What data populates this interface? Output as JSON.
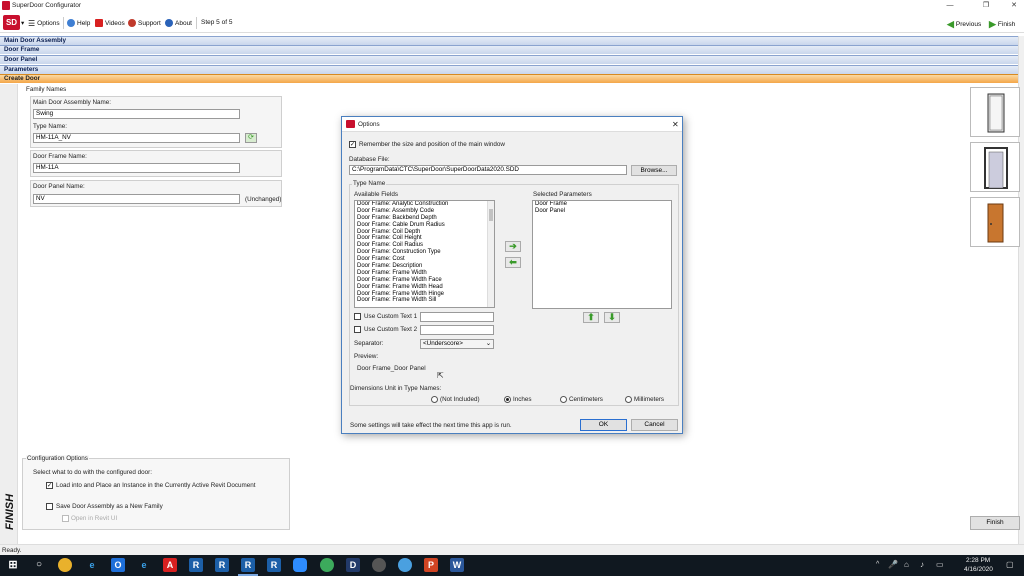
{
  "window": {
    "title": "SuperDoor Configurator",
    "app_logo": "SD"
  },
  "toolbar": {
    "options": "Options",
    "help": "Help",
    "videos": "Videos",
    "support": "Support",
    "about": "About",
    "step": "Step 5 of 5",
    "previous": "Previous",
    "finish": "Finish"
  },
  "sections": [
    "Main Door Assembly",
    "Door Frame",
    "Door Panel",
    "Parameters",
    "Create Door"
  ],
  "family_names": {
    "group_title": "Family Names",
    "main_assembly_label": "Main Door Assembly Name:",
    "main_assembly_value": "Swing",
    "type_name_label": "Type Name:",
    "type_name_value": "HM-11A_NV",
    "frame_label": "Door Frame Name:",
    "frame_value": "HM-11A",
    "panel_label": "Door Panel Name:",
    "panel_value": "NV",
    "panel_status": "(Unchanged)"
  },
  "config": {
    "group_title": "Configuration Options",
    "prompt": "Select what to do with the configured door:",
    "opt1": "Load into and Place an Instance in the Currently Active Revit Document",
    "opt2": "Save Door Assembly as a New Family",
    "opt3": "Open in Revit UI",
    "opt1_checked": true,
    "opt2_checked": false
  },
  "finish_vertical": "FINISH",
  "finish_button": "Finish",
  "status": "Ready.",
  "dialog": {
    "title": "Options",
    "remember": "Remember the size and position of the main window",
    "db_label": "Database File:",
    "db_value": "C:\\ProgramData\\CTC\\SuperDoor\\SuperDoorData2020.SDD",
    "browse": "Browse...",
    "type_name_group": "Type Name",
    "available_label": "Available Fields",
    "selected_label": "Selected Parameters",
    "available_fields": [
      "Door Frame: Analytic Construction",
      "Door Frame: Assembly Code",
      "Door Frame: Backbend Depth",
      "Door Frame: Cable Drum Radius",
      "Door Frame: Coil Depth",
      "Door Frame: Coil Height",
      "Door Frame: Coil Radius",
      "Door Frame: Construction Type",
      "Door Frame: Cost",
      "Door Frame: Description",
      "Door Frame: Frame Width",
      "Door Frame: Frame Width Face",
      "Door Frame: Frame Width Head",
      "Door Frame: Frame Width Hinge",
      "Door Frame: Frame Width Sill"
    ],
    "selected_params": [
      "Door Frame",
      "Door Panel"
    ],
    "custom1": "Use Custom Text 1",
    "custom2": "Use Custom Text 2",
    "separator_label": "Separator:",
    "separator_value": "<Underscore>",
    "preview_label": "Preview:",
    "preview_value": "Door Frame_Door Panel",
    "units_label": "Dimensions Unit in Type Names:",
    "units": [
      "(Not Included)",
      "Inches",
      "Centimeters",
      "Millimeters"
    ],
    "units_selected": "Inches",
    "note": "Some settings will take effect the next time this app is run.",
    "ok": "OK",
    "cancel": "Cancel"
  },
  "clock": {
    "time": "2:28 PM",
    "date": "4/16/2020"
  },
  "colors": {
    "accent_orange": "#f4a648",
    "section_blue": "#c9d6ec",
    "dialog_border": "#4a7fbf"
  }
}
